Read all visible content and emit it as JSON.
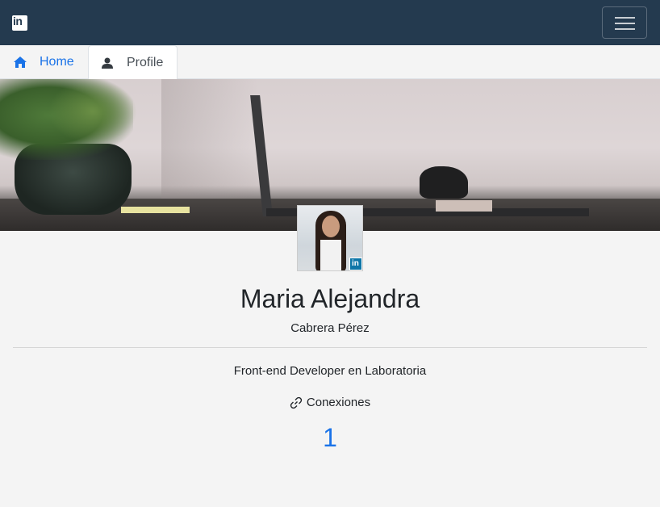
{
  "navbar": {
    "logo_text": "in",
    "logo_icon": "linkedin-logo",
    "menu_icon": "hamburger-icon"
  },
  "tabs": [
    {
      "label": "Home",
      "icon": "home-icon",
      "active": false,
      "color": "#1a73e8"
    },
    {
      "label": "Profile",
      "icon": "user-icon",
      "active": true
    }
  ],
  "profile": {
    "name": "Maria Alejandra",
    "surname": "Cabrera Pérez",
    "headline": "Front-end Developer en Laboratoria",
    "connections_label": "Conexiones",
    "connections_icon": "link-icon",
    "connections_count": "1",
    "avatar_badge_text": "in"
  },
  "colors": {
    "navbar": "#243a4f",
    "accent": "#1a73e8",
    "background": "#f4f4f4",
    "linkedin_blue": "#0e76a8"
  }
}
